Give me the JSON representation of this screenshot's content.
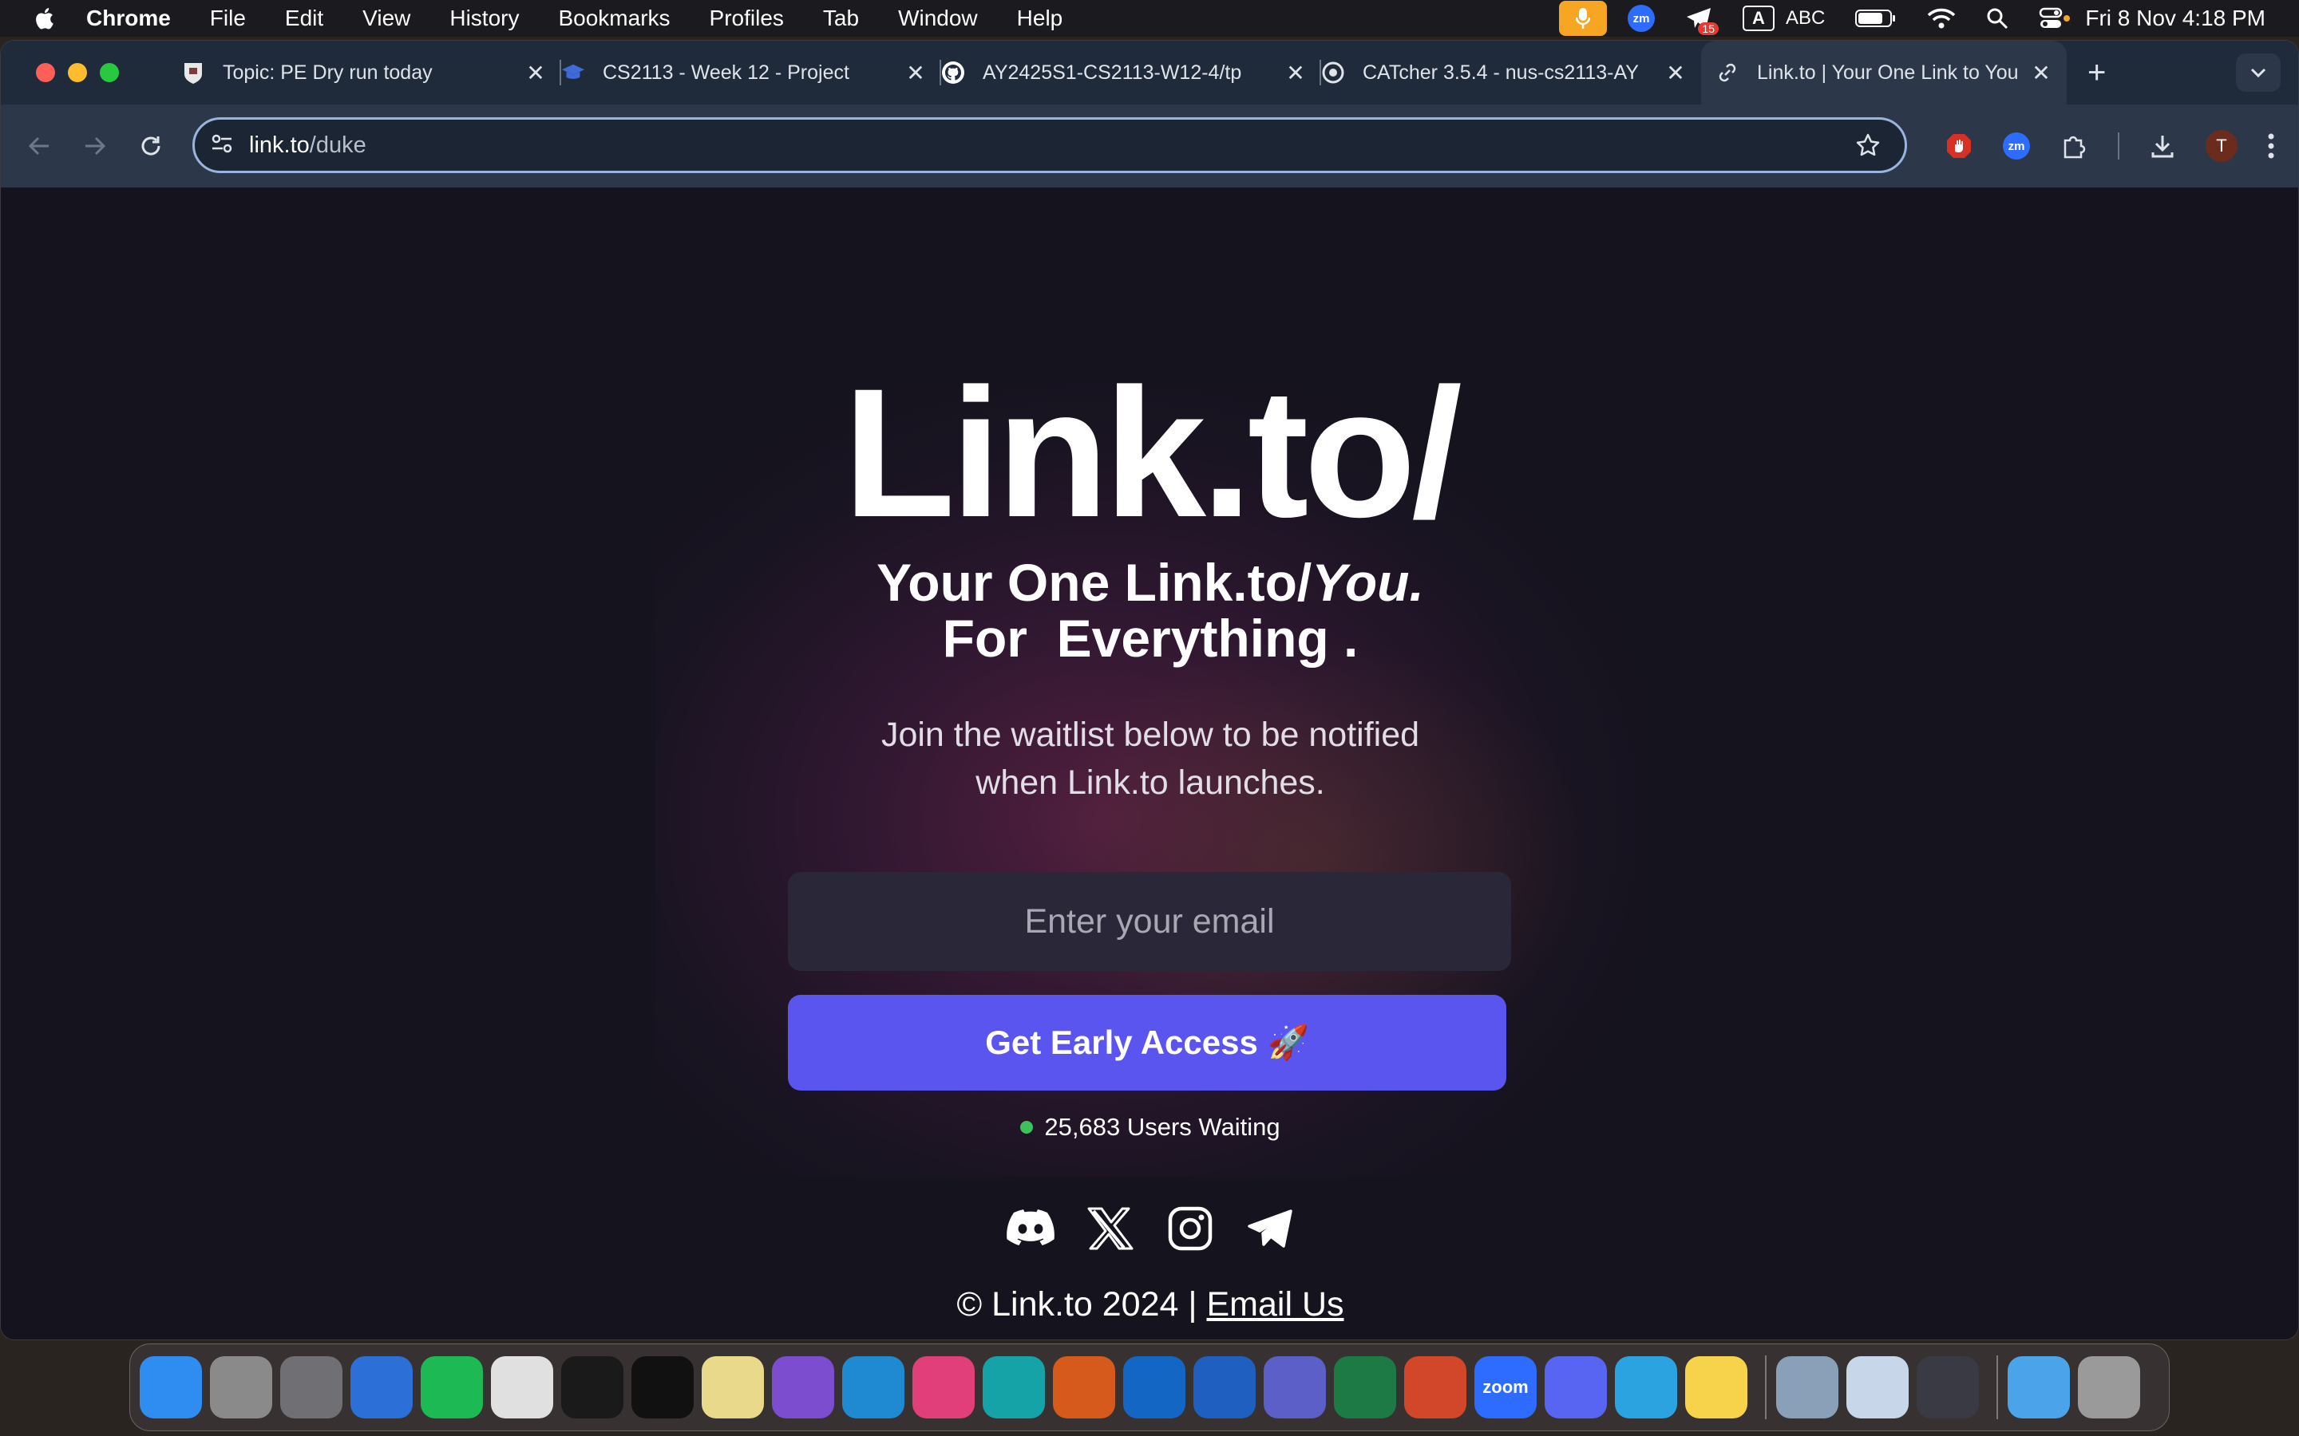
{
  "menubar": {
    "app_name": "Chrome",
    "items": [
      "File",
      "Edit",
      "View",
      "History",
      "Bookmarks",
      "Profiles",
      "Tab",
      "Window",
      "Help"
    ],
    "input_source": "ABC",
    "input_badge": "A",
    "telegram_badge": "15",
    "zoom_label": "zm",
    "clock": "Fri 8 Nov  4:18 PM"
  },
  "tabs": [
    {
      "title": "Topic: PE Dry run today",
      "icon": "forum-icon"
    },
    {
      "title": "CS2113 - Week 12 - Project",
      "icon": "graduation-cap-icon"
    },
    {
      "title": "AY2425S1-CS2113-W12-4/tp",
      "icon": "github-icon"
    },
    {
      "title": "CATcher 3.5.4 - nus-cs2113-AY",
      "icon": "catcher-icon"
    },
    {
      "title": "Link.to | Your One Link to You",
      "icon": "link-icon",
      "active": true
    }
  ],
  "address_bar": {
    "host": "link.to",
    "path": "/duke"
  },
  "profile_initial": "T",
  "hero": {
    "logo": "Link.to/",
    "tagline_line1": "Your One Link.to/",
    "tagline_you": "You.",
    "tagline_line2": "For  Everything .",
    "subtitle_line1": "Join the waitlist below to be notified",
    "subtitle_line2": "when Link.to launches."
  },
  "form": {
    "email_placeholder": "Enter your email",
    "cta_label": "Get Early Access 🚀"
  },
  "waiting": {
    "count_text": "25,683 Users Waiting"
  },
  "socials": [
    "discord-icon",
    "x-icon",
    "instagram-icon",
    "telegram-icon"
  ],
  "footer": {
    "copyright": "© Link.to 2024 |",
    "email_link": "Email Us"
  },
  "colors": {
    "accent": "#5b55f0",
    "page_bg": "#15131e",
    "status_green": "#3ec05a"
  },
  "dock_apps": [
    {
      "name": "Finder",
      "color": "#2f8cf0"
    },
    {
      "name": "Launchpad",
      "color": "#8a8a8a"
    },
    {
      "name": "System Settings",
      "color": "#6f6f74"
    },
    {
      "name": "Bitwarden",
      "color": "#2c6fd6"
    },
    {
      "name": "Spotify",
      "color": "#1db954"
    },
    {
      "name": "Chrome",
      "color": "#e0e0e0"
    },
    {
      "name": "Terminal",
      "color": "#1a1a1a"
    },
    {
      "name": "iTerm",
      "color": "#111111"
    },
    {
      "name": "Python",
      "color": "#e9d98a"
    },
    {
      "name": "Visual Studio",
      "color": "#7c4dce"
    },
    {
      "name": "VS Code",
      "color": "#1f8ad2"
    },
    {
      "name": "IntelliJ IDEA",
      "color": "#e03f7a"
    },
    {
      "name": "Arduino",
      "color": "#16a3a8"
    },
    {
      "name": "MATLAB",
      "color": "#d65a1b"
    },
    {
      "name": "Outlook",
      "color": "#1466c4"
    },
    {
      "name": "Word",
      "color": "#1f5fbf"
    },
    {
      "name": "Teams",
      "color": "#5b5fc7"
    },
    {
      "name": "Excel",
      "color": "#1d7a45"
    },
    {
      "name": "PowerPoint",
      "color": "#d2472a"
    },
    {
      "name": "Zoom",
      "color": "#2d6cff",
      "label": "zoom"
    },
    {
      "name": "Discord",
      "color": "#5865f2"
    },
    {
      "name": "Telegram",
      "color": "#2aa3e0"
    },
    {
      "name": "Notes",
      "color": "#f7d24b"
    },
    {
      "name": "Preview",
      "color": "#8aa0b8"
    },
    {
      "name": "Screen Saver",
      "color": "#c8d6ea"
    },
    {
      "name": "QuickTime",
      "color": "#3a3a44"
    },
    {
      "name": "Downloads Folder",
      "color": "#4ba3ea"
    },
    {
      "name": "Trash",
      "color": "#9a9a9a"
    }
  ]
}
